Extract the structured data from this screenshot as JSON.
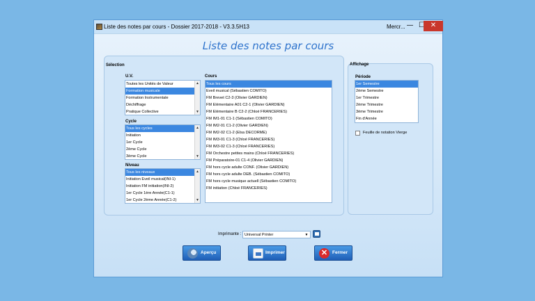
{
  "window": {
    "title": "Liste des notes par cours  -  Dossier 2017-2018  -  V3.3.5H13",
    "title_right": "Mercr...",
    "controls": {
      "minimize": "—",
      "maximize": "☐",
      "close": "✕"
    }
  },
  "heading": "Liste des notes par cours",
  "selection": {
    "legend": "Sélection",
    "uv": {
      "label": "U.V.",
      "items": [
        "Toutes les Unités de Valeur",
        "Formation musicale",
        "Formation Instrumentale",
        "Déchiffrage",
        "Pratique Collective"
      ],
      "selected_index": 1
    },
    "cycle": {
      "label": "Cycle",
      "items": [
        "Tous les cycles",
        "Initiation",
        "1er Cycle",
        "2ème Cycle",
        "3ème Cycle"
      ],
      "selected_index": 0
    },
    "niveau": {
      "label": "Niveau",
      "items": [
        "Tous les niveaux",
        "Initiation Eveil musical(INI-1)",
        "Initiation FM initiation(INI-2)",
        "1er Cycle 1ère Année(C1-1)",
        "1er Cycle 2ème Année(C1-2)"
      ],
      "selected_index": 0
    },
    "cours": {
      "label": "Cours",
      "items": [
        "Tous les cours",
        "Eveil musical (Sébastien COMITO)",
        "FM Brevet C2-3 (Olivier GARDIEN)",
        "FM Elémentaire A01  C2-1 (Olivier GARDIEN)",
        "FM Elémentaire B  C2-2 (Chloé FRANCERIES)",
        "FM IM1-01 C1-1 (Sébastien COMITO)",
        "FM IM2-01 C1-2 (Olivier GARDIEN)",
        "FM IM2-02 C1-2 (Elsa DECORME)",
        "FM IM3-01 C1-3 (Chloé FRANCERIES)",
        "FM IM3-02 C1-3 (Chloé FRANCERIES)",
        "FM Orchestre petites mains (Chloé FRANCERIES)",
        "FM Préparatoire-01 C1-4 (Olivier GARDIEN)",
        "FM hors cycle adulte CONF. (Olivier GARDIEN)",
        "FM hors cycle adulte DEB. (Sébastien COMITO)",
        "FM hors cycle musique actuell (Sébastien COMITO)",
        "FM initiation (Chloé FRANCERIES)"
      ],
      "selected_index": 0
    }
  },
  "affichage": {
    "legend": "Affichage",
    "periode": {
      "label": "Période",
      "items": [
        "1er  Semestre",
        "2ème Semestre",
        "1er  Trimestre",
        "2ème Trimestre",
        "3ème Trimestre",
        "Fin d'Année"
      ],
      "selected_index": 0
    },
    "feuille_vierge": {
      "label": "Feuille de notation Vierge",
      "checked": false
    }
  },
  "printer": {
    "label": "Imprimante :",
    "value": "Universal Printer"
  },
  "buttons": {
    "apercu": "Aperçu",
    "imprimer": "Imprimer",
    "fermer": "Fermer"
  },
  "colors": {
    "background": "#7ab7e6",
    "accent": "#3b87e0",
    "heading": "#2e73cc",
    "close": "#c9372c"
  }
}
